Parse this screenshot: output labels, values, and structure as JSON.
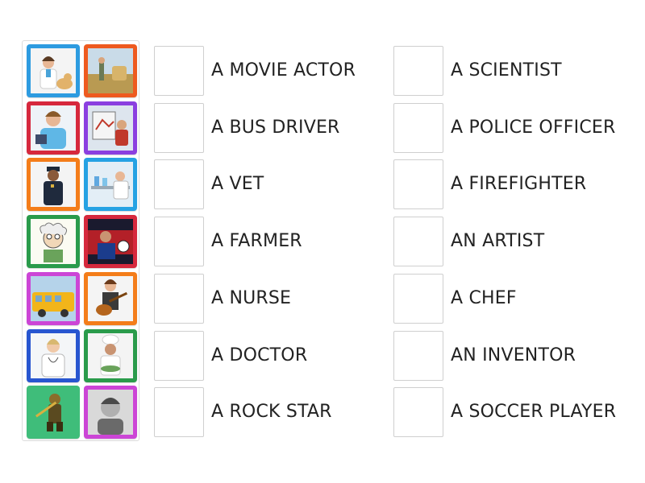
{
  "tiles": [
    {
      "icon": "vet-with-dog-image",
      "color": "#2d9be0"
    },
    {
      "icon": "farmer-field-image",
      "color": "#ee5a1f"
    },
    {
      "icon": "nurse-image",
      "color": "#d6283d"
    },
    {
      "icon": "artist-painting-image",
      "color": "#8b3fe0"
    },
    {
      "icon": "police-officer-image",
      "color": "#f47d1a"
    },
    {
      "icon": "scientist-lab-image",
      "color": "#26a2e3"
    },
    {
      "icon": "inventor-cartoon-image",
      "color": "#2a9b4b"
    },
    {
      "icon": "soccer-player-image",
      "color": "#d6283d"
    },
    {
      "icon": "school-bus-image",
      "color": "#cc45d6"
    },
    {
      "icon": "rock-star-guitar-image",
      "color": "#f47d1a"
    },
    {
      "icon": "doctor-image",
      "color": "#2856d0"
    },
    {
      "icon": "chef-image",
      "color": "#2a9b4b"
    },
    {
      "icon": "firefighter-image",
      "color": "#3fbd7a"
    },
    {
      "icon": "movie-actor-portrait-image",
      "color": "#cc45d6"
    }
  ],
  "left_labels": [
    "A MOVIE ACTOR",
    "A BUS DRIVER",
    "A VET",
    "A FARMER",
    "A NURSE",
    "A DOCTOR",
    "A ROCK STAR"
  ],
  "right_labels": [
    "A SCIENTIST",
    "A POLICE OFFICER",
    "A FIREFIGHTER",
    "AN ARTIST",
    "A CHEF",
    "AN INVENTOR",
    "A SOCCER PLAYER"
  ]
}
